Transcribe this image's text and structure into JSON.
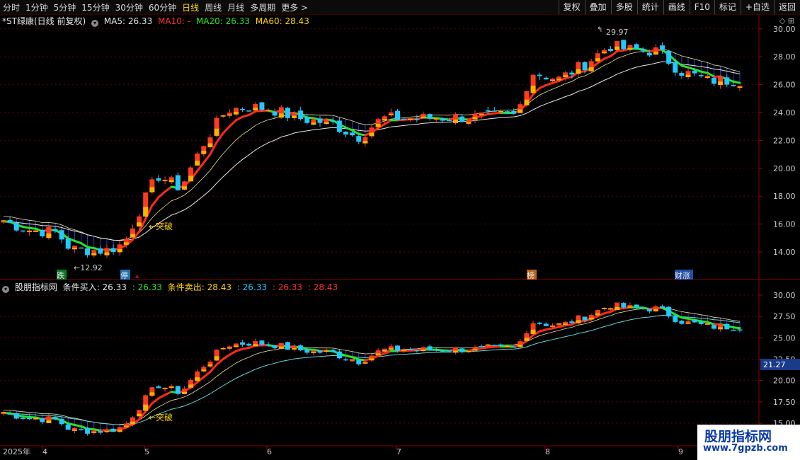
{
  "toolbar": {
    "periods": [
      "分时",
      "1分钟",
      "5分钟",
      "15分钟",
      "30分钟",
      "60分钟",
      "日线",
      "周线",
      "月线",
      "多周期",
      "更多 >"
    ],
    "active_period": "日线",
    "tools": [
      "复权",
      "叠加",
      "多股",
      "统计",
      "画线",
      "F10",
      "标记",
      "+自选",
      "返回"
    ]
  },
  "main_header": {
    "title": "*ST绿康(日线 前复权)",
    "ma5": "MA5: 26.33",
    "ma10": "MA10: -",
    "ma20": "MA20: 26.33",
    "ma60": "MA60: 28.43"
  },
  "sub_header": {
    "name": "股朋指标网",
    "buy_label": "条件买入: 26.33",
    "v1": ": 26.33",
    "sell_label": "条件卖出: 28.43",
    "v2": ": 26.33",
    "v3": ": 26.33",
    "v4": ": 28.43"
  },
  "annotations": {
    "break_main": "←突破",
    "break_sub": "←突破",
    "low": "←12.92",
    "high": "29.97",
    "tags": [
      "跌",
      "停",
      "榜",
      "财涨"
    ]
  },
  "price_box": "21.27",
  "x_axis": {
    "year": "2025年",
    "months": [
      "4",
      "5",
      "6",
      "7",
      "8",
      "9"
    ]
  },
  "main_y_ticks": [
    "30.00",
    "28.00",
    "26.00",
    "24.00",
    "22.00",
    "20.00",
    "18.00",
    "16.00",
    "14.00"
  ],
  "sub_y_ticks": [
    "30.00",
    "27.50",
    "25.00",
    "22.50",
    "20.00",
    "17.50",
    "15.00"
  ],
  "watermark": {
    "line1": "股朋指标网",
    "line2": "www.7gpzb.com"
  },
  "colors": {
    "up": "#ff3b1e",
    "down": "#22c8ff",
    "ma_up": "#ff2a1a",
    "ma_down": "#22e62a",
    "ma60": "#e8e8e8",
    "band": "#3a4cff",
    "yellow": "#ffd400"
  }
}
